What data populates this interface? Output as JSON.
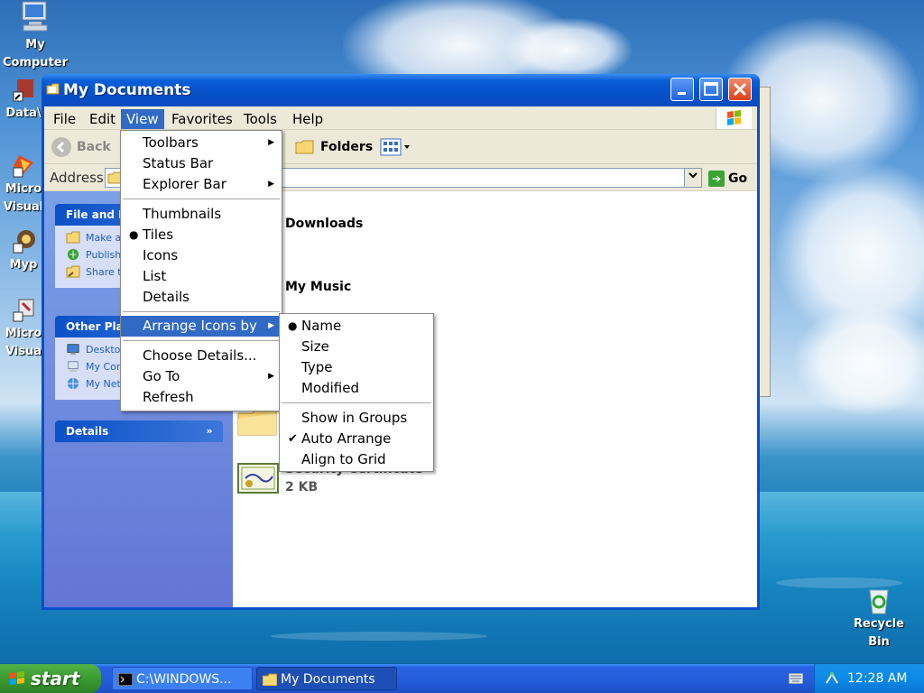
{
  "desktop": {
    "icons": [
      {
        "label": "My Computer"
      },
      {
        "label": "Data\\"
      },
      {
        "label": "Micro Visual"
      },
      {
        "label": "Myp"
      },
      {
        "label": "Micro Visua"
      },
      {
        "label": "Recycle Bin"
      }
    ]
  },
  "window": {
    "title": "My Documents",
    "menu": [
      "File",
      "Edit",
      "View",
      "Favorites",
      "Tools",
      "Help"
    ],
    "toolbar": {
      "back": "Back",
      "folders": "Folders"
    },
    "address": {
      "label": "Address",
      "go": "Go"
    },
    "left_pane": {
      "file_folder_tasks": {
        "title": "File and Fo",
        "tasks": [
          "Make a",
          "Publish Web",
          "Share th"
        ]
      },
      "other_places": {
        "title": "Other Plac",
        "items": [
          "Desktop",
          "My Com",
          "My Netw"
        ]
      },
      "details": {
        "title": "Details"
      }
    },
    "content": {
      "items": [
        {
          "name": "Downloads"
        },
        {
          "name": "My Music"
        },
        {
          "name": "Security Certificate",
          "size": "2 KB"
        }
      ]
    }
  },
  "view_menu": {
    "items": [
      {
        "label": "Toolbars",
        "submenu": true
      },
      {
        "label": "Status Bar"
      },
      {
        "label": "Explorer Bar",
        "submenu": true
      },
      {
        "label": "Thumbnails"
      },
      {
        "label": "Tiles",
        "bullet": true
      },
      {
        "label": "Icons"
      },
      {
        "label": "List"
      },
      {
        "label": "Details"
      },
      {
        "label": "Arrange Icons by",
        "submenu": true,
        "highlighted": true
      },
      {
        "label": "Choose Details..."
      },
      {
        "label": "Go To",
        "submenu": true
      },
      {
        "label": "Refresh"
      }
    ]
  },
  "arrange_menu": {
    "items": [
      {
        "label": "Name",
        "bullet": true
      },
      {
        "label": "Size"
      },
      {
        "label": "Type"
      },
      {
        "label": "Modified"
      },
      {
        "label": "Show in Groups"
      },
      {
        "label": "Auto Arrange",
        "check": true
      },
      {
        "label": "Align to Grid"
      }
    ]
  },
  "taskbar": {
    "start": "start",
    "tasks": [
      "C:\\WINDOWS...",
      "My Documents"
    ],
    "clock": "12:28 AM"
  },
  "colors": {
    "selection": "#316ac5",
    "title_blue": "#0550c8",
    "start_green": "#3c9b32"
  }
}
